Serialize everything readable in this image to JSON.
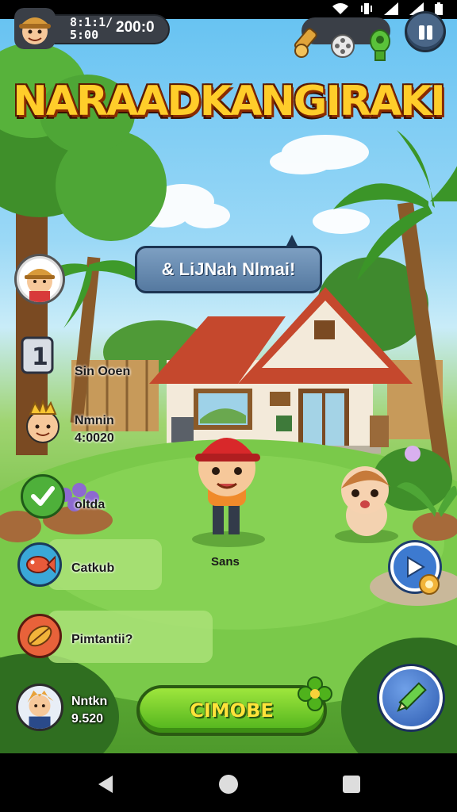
{
  "hud": {
    "time_line1": "8:1:1/",
    "time_line2": "5:00",
    "score": "200:0",
    "pause_icon": "pause-icon"
  },
  "title": "NARAADKANGIRAKI",
  "speech_bubble": "& LiJNah Nlmai!",
  "side_menu": [
    {
      "label": "Sin Ooen",
      "icon": "number-one-icon"
    },
    {
      "label_line1": "Nmnin",
      "label_line2": "4:0020",
      "icon": "crowned-character-icon"
    },
    {
      "label": "oltda",
      "icon": "checkmark-icon"
    },
    {
      "label": "Catkub",
      "icon": "fish-icon"
    },
    {
      "label": "Pimtantii?",
      "icon": "leaf-icon"
    },
    {
      "label_line1": "Nntkn",
      "label_line2": "9.520",
      "icon": "character-portrait-icon"
    }
  ],
  "character_label": "Sans",
  "cta_button": "CIMOBE",
  "colors": {
    "sky": "#68c3f2",
    "grass": "#6cbb3c",
    "title_fill": "#ffcd2a",
    "cta_green": "#4fb21c",
    "bubble_blue": "#5579a0"
  }
}
